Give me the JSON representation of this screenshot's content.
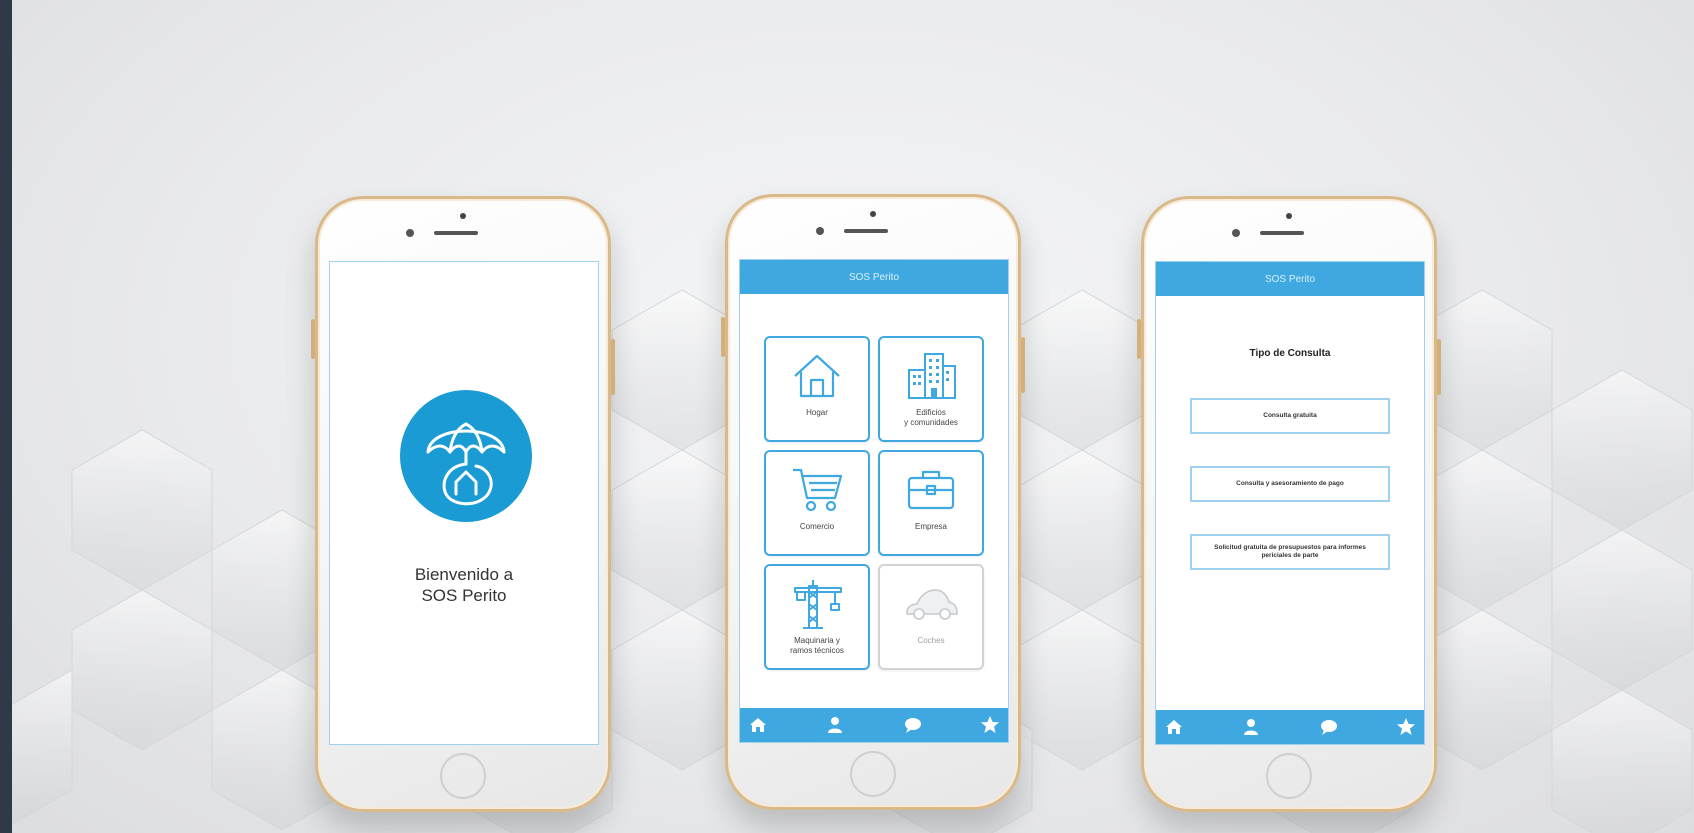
{
  "theme": {
    "accent": "#3fa8e0",
    "logo_blue": "#1a9bd4",
    "frame_gold": "#d9b98a"
  },
  "welcome": {
    "line1": "Bienvenido a",
    "line2": "SOS Perito",
    "logo_icon": "umbrella-house-logo-icon"
  },
  "app": {
    "header_title": "SOS Perito"
  },
  "categories": [
    {
      "label": "Hogar",
      "icon": "house-icon",
      "enabled": true
    },
    {
      "label": "Edificios\ny comunidades",
      "icon": "buildings-icon",
      "enabled": true
    },
    {
      "label": "Comercio",
      "icon": "shopping-cart-icon",
      "enabled": true
    },
    {
      "label": "Empresa",
      "icon": "briefcase-icon",
      "enabled": true
    },
    {
      "label": "Maquinaria y\nramos técnicos",
      "icon": "crane-icon",
      "enabled": true
    },
    {
      "label": "Coches",
      "icon": "car-icon",
      "enabled": false
    }
  ],
  "consulta": {
    "title": "Tipo de Consulta",
    "options": [
      "Consulta gratuita",
      "Consulta y asesoramiento de pago",
      "Solicitud gratuita de presupuestos para informes periciales de parte"
    ]
  },
  "footer_nav": [
    {
      "icon": "home-icon"
    },
    {
      "icon": "user-icon"
    },
    {
      "icon": "chat-icon"
    },
    {
      "icon": "star-icon"
    }
  ]
}
